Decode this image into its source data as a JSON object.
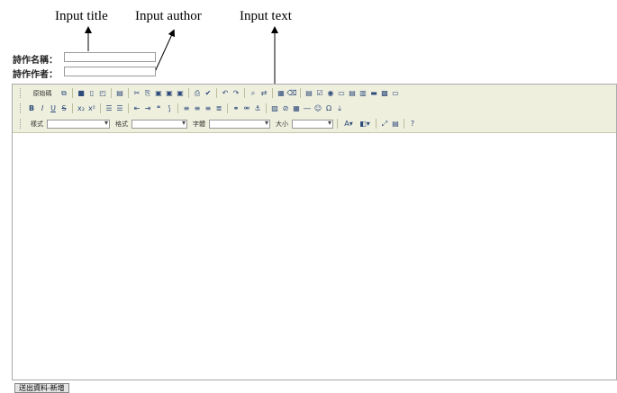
{
  "annotations": {
    "title": "Input title",
    "author": "Input author",
    "text": "Input text"
  },
  "form": {
    "title_label": "詩作名稱：",
    "author_label": "詩作作者：",
    "title_value": "",
    "author_value": ""
  },
  "editor": {
    "source_button": "原始碼",
    "style_label": "樣式",
    "format_label": "格式",
    "font_label": "字體",
    "size_label": "大小",
    "style_value": "",
    "format_value": "",
    "font_value": "",
    "size_value": "",
    "content": ""
  },
  "submit_label": "送出資料-新增",
  "colors": {
    "toolbar_bg": "#efefde",
    "icon": "#2c4a7a"
  }
}
